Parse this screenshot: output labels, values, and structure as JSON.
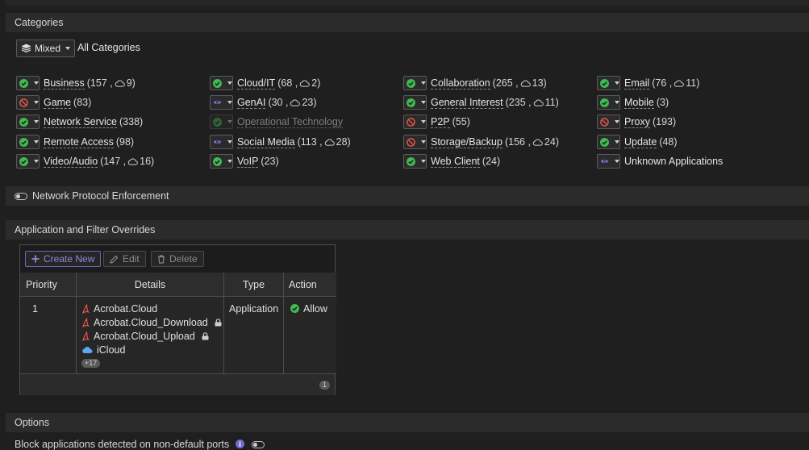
{
  "sections": {
    "categories": "Categories",
    "protocol": "Network Protocol Enforcement",
    "overrides": "Application and Filter Overrides",
    "options": "Options"
  },
  "mixed": {
    "label": "Mixed",
    "all_label": "All Categories"
  },
  "categories": [
    {
      "name": "Business",
      "count": "(157 ,",
      "cloud": "9)",
      "action": "allow"
    },
    {
      "name": "Cloud/IT",
      "count": "(68 ,",
      "cloud": "2)",
      "action": "allow"
    },
    {
      "name": "Collaboration",
      "count": "(265 ,",
      "cloud": "13)",
      "action": "allow"
    },
    {
      "name": "Email",
      "count": "(76 ,",
      "cloud": "11)",
      "action": "allow"
    },
    {
      "name": "Game",
      "count": "(83)",
      "action": "block"
    },
    {
      "name": "GenAI",
      "count": "(30 ,",
      "cloud": "23)",
      "action": "monitor"
    },
    {
      "name": "General Interest",
      "count": "(235 ,",
      "cloud": "11)",
      "action": "allow"
    },
    {
      "name": "Mobile",
      "count": "(3)",
      "action": "allow"
    },
    {
      "name": "Network Service",
      "count": "(338)",
      "action": "allow"
    },
    {
      "name": "Operational Technology",
      "count": "",
      "action": "allow-disabled"
    },
    {
      "name": "P2P",
      "count": "(55)",
      "action": "block"
    },
    {
      "name": "Proxy",
      "count": "(193)",
      "action": "block"
    },
    {
      "name": "Remote Access",
      "count": "(98)",
      "action": "allow"
    },
    {
      "name": "Social Media",
      "count": "(113 ,",
      "cloud": "28)",
      "action": "monitor"
    },
    {
      "name": "Storage/Backup",
      "count": "(156 ,",
      "cloud": "24)",
      "action": "block"
    },
    {
      "name": "Update",
      "count": "(48)",
      "action": "allow"
    },
    {
      "name": "Video/Audio",
      "count": "(147 ,",
      "cloud": "16)",
      "action": "allow"
    },
    {
      "name": "VoIP",
      "count": "(23)",
      "action": "allow"
    },
    {
      "name": "Web Client",
      "count": "(24)",
      "action": "allow"
    },
    {
      "name": "Unknown Applications",
      "count": "",
      "action": "monitor"
    }
  ],
  "toolbar": {
    "create": "Create New",
    "edit": "Edit",
    "delete": "Delete"
  },
  "table": {
    "headers": [
      "Priority",
      "Details",
      "Type",
      "Action"
    ],
    "row": {
      "priority": "1",
      "details": [
        {
          "label": "Acrobat.Cloud",
          "lock": false,
          "icon": "acrobat-icon"
        },
        {
          "label": "Acrobat.Cloud_Download",
          "lock": true,
          "icon": "acrobat-icon"
        },
        {
          "label": "Acrobat.Cloud_Upload",
          "lock": true,
          "icon": "acrobat-icon"
        },
        {
          "label": "iCloud",
          "lock": false,
          "icon": "icloud-icon"
        }
      ],
      "more": "+17",
      "type": "Application",
      "action": "Allow"
    },
    "page_count": "1"
  },
  "options": {
    "block_non_default": "Block applications detected on non-default ports"
  },
  "colors": {
    "allow": "#3fb950",
    "block": "#e5534b",
    "monitor": "#7b79d8",
    "accent": "#8e8ad8"
  }
}
